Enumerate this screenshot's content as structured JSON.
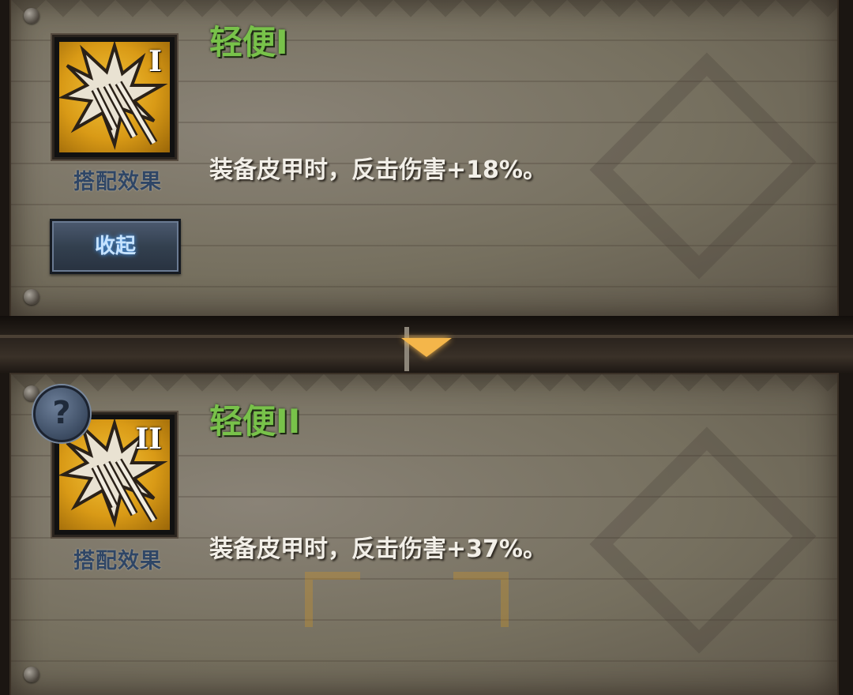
{
  "sets": [
    {
      "title": "轻便I",
      "tier": "I",
      "caption": "搭配效果",
      "description": "装备皮甲时，反击伤害+18%。"
    },
    {
      "title": "轻便II",
      "tier": "II",
      "caption": "搭配效果",
      "description": "装备皮甲时，反击伤害+37%。"
    }
  ],
  "collapse_label": "收起",
  "help_label": "?",
  "icons": {
    "set_icon": "burst-claw-icon",
    "help": "question-icon",
    "expand": "down-arrow-icon"
  },
  "colors": {
    "title_green": "#78c24a",
    "icon_gold": "#d99a16",
    "button_blue": "#33404f"
  }
}
